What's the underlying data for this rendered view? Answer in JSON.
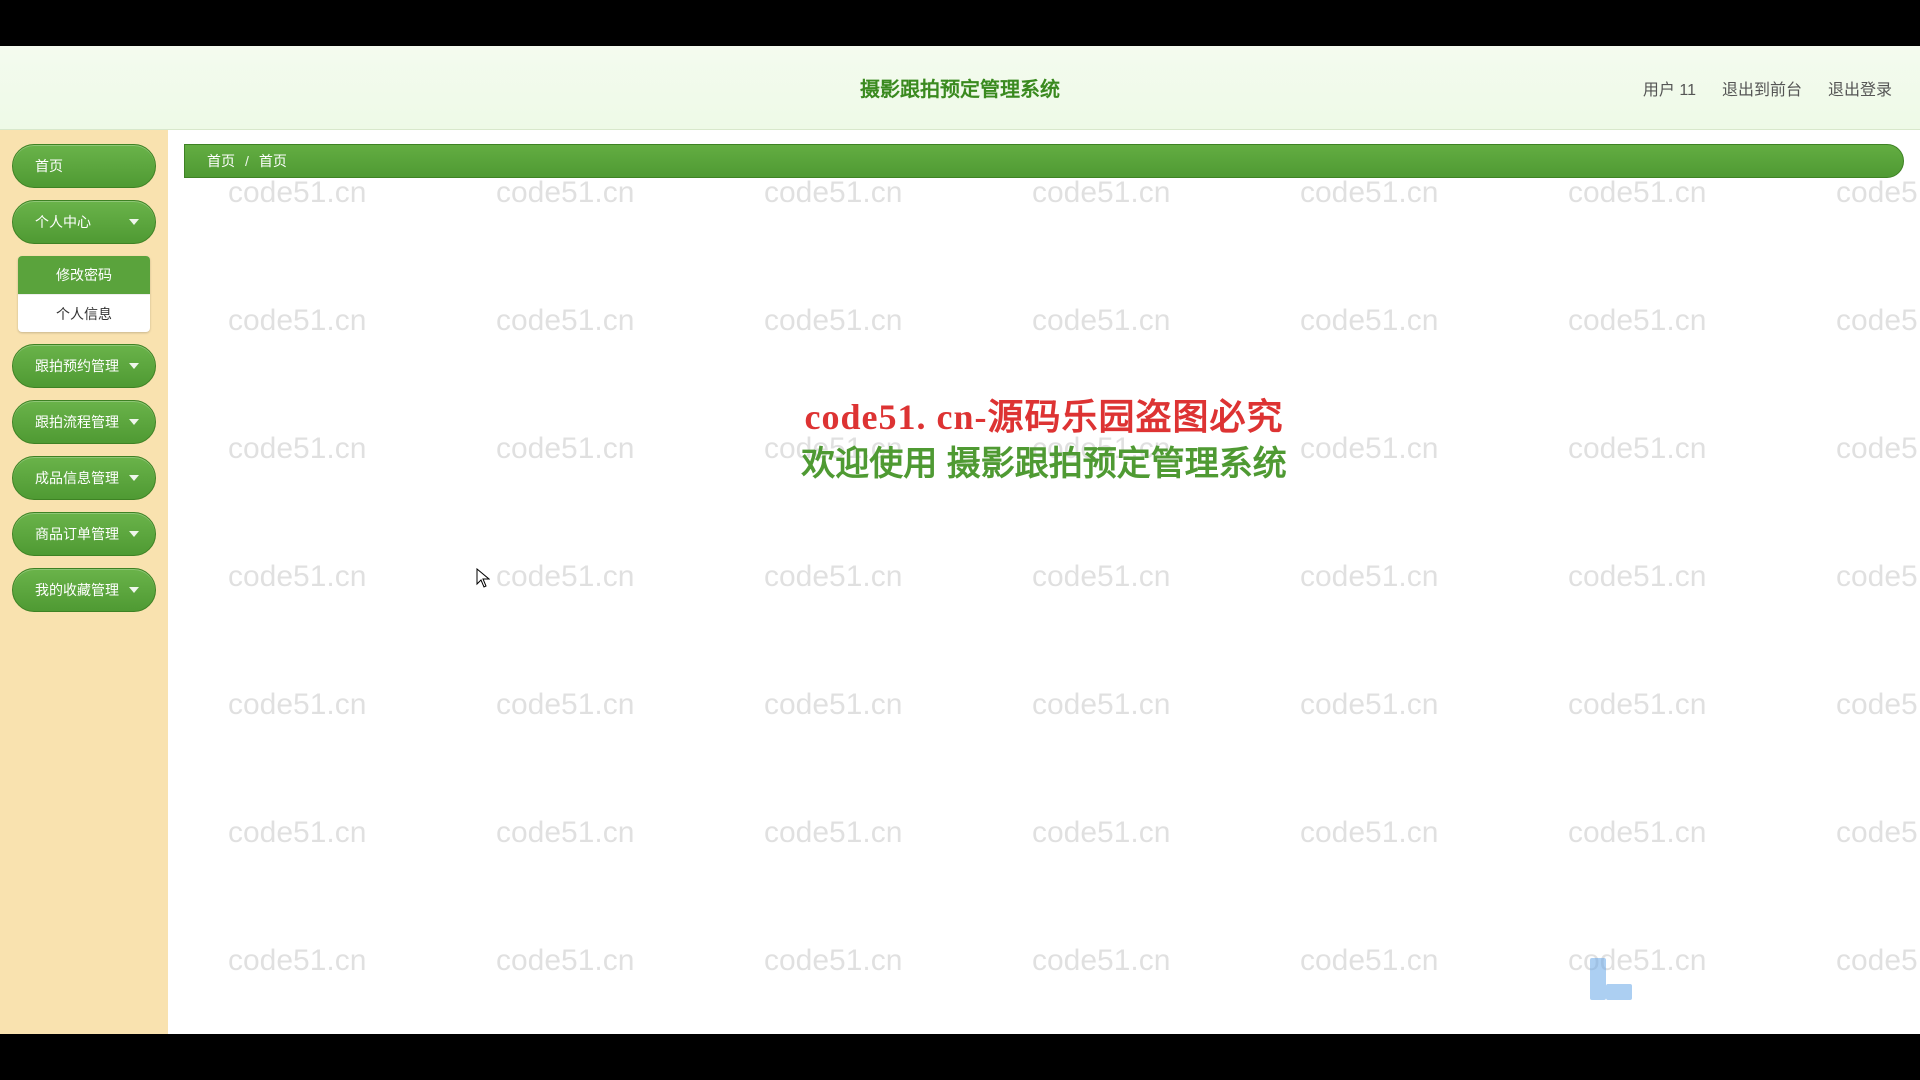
{
  "watermark_text": "code51.cn",
  "header": {
    "title": "摄影跟拍预定管理系统",
    "user_label": "用户 11",
    "exit_front": "退出到前台",
    "logout": "退出登录"
  },
  "sidebar": {
    "home": "首页",
    "items": [
      {
        "label": "个人中心",
        "expanded": true,
        "children": [
          {
            "label": "修改密码",
            "selected": true
          },
          {
            "label": "个人信息",
            "selected": false
          }
        ]
      },
      {
        "label": "跟拍预约管理",
        "expanded": false
      },
      {
        "label": "跟拍流程管理",
        "expanded": false
      },
      {
        "label": "成品信息管理",
        "expanded": false
      },
      {
        "label": "商品订单管理",
        "expanded": false
      },
      {
        "label": "我的收藏管理",
        "expanded": false
      }
    ]
  },
  "breadcrumb": {
    "root": "首页",
    "current": "首页"
  },
  "content": {
    "banner_red": "code51. cn-源码乐园盗图必究",
    "banner_green": "欢迎使用 摄影跟拍预定管理系统"
  }
}
